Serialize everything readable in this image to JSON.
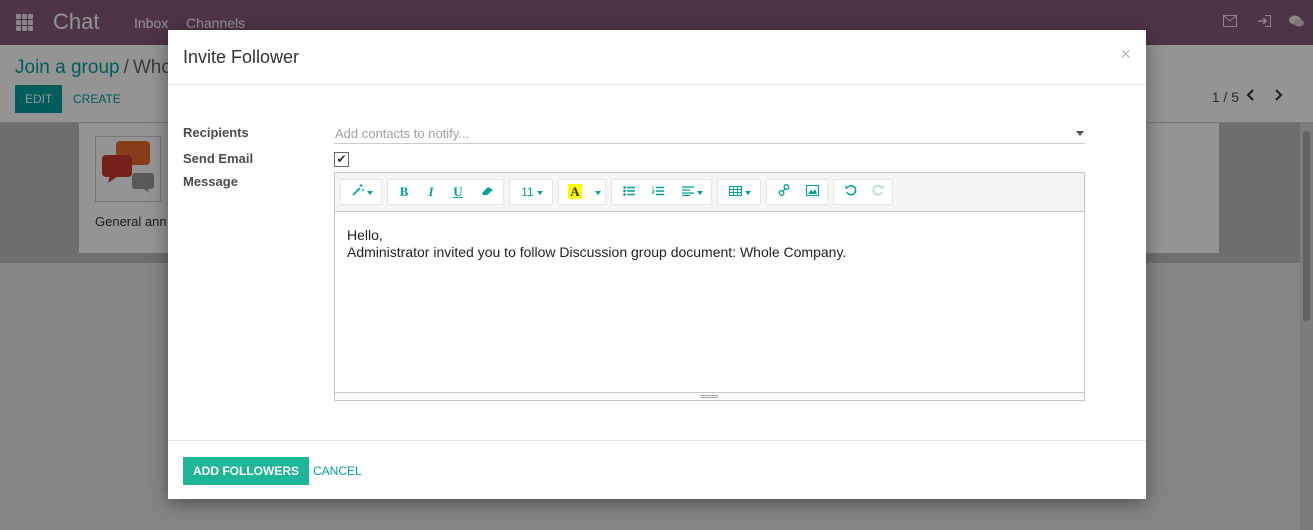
{
  "topbar": {
    "app_title": "Chat",
    "nav": [
      "Inbox",
      "Channels"
    ],
    "icons": [
      "apps-grid-icon",
      "envelope-icon",
      "sign-in-icon",
      "comments-icon"
    ]
  },
  "breadcrumb": {
    "parent": "Join a group",
    "separator": "/",
    "current": "Who"
  },
  "actions": {
    "edit": "EDIT",
    "create": "CREATE"
  },
  "pager": {
    "value": "1 / 5",
    "prev": "‹",
    "next": "›"
  },
  "record": {
    "description": "General ann"
  },
  "modal": {
    "title": "Invite Follower",
    "close": "×",
    "labels": {
      "recipients": "Recipients",
      "send_email": "Send Email",
      "message": "Message"
    },
    "recipients_placeholder": "Add contacts to notify...",
    "send_email_checked": true,
    "checkmark": "✔",
    "toolbar": {
      "font_size": "11",
      "highlight": "A",
      "bold": "B",
      "italic": "I",
      "underline": "U"
    },
    "message_lines": [
      "Hello,",
      "Administrator invited you to follow Discussion group document: Whole Company."
    ],
    "buttons": {
      "add_followers": "ADD FOLLOWERS",
      "cancel": "CANCEL"
    }
  },
  "colors": {
    "brand": "#875a7b",
    "accent": "#00a09d",
    "primary_button": "#1fb597"
  }
}
